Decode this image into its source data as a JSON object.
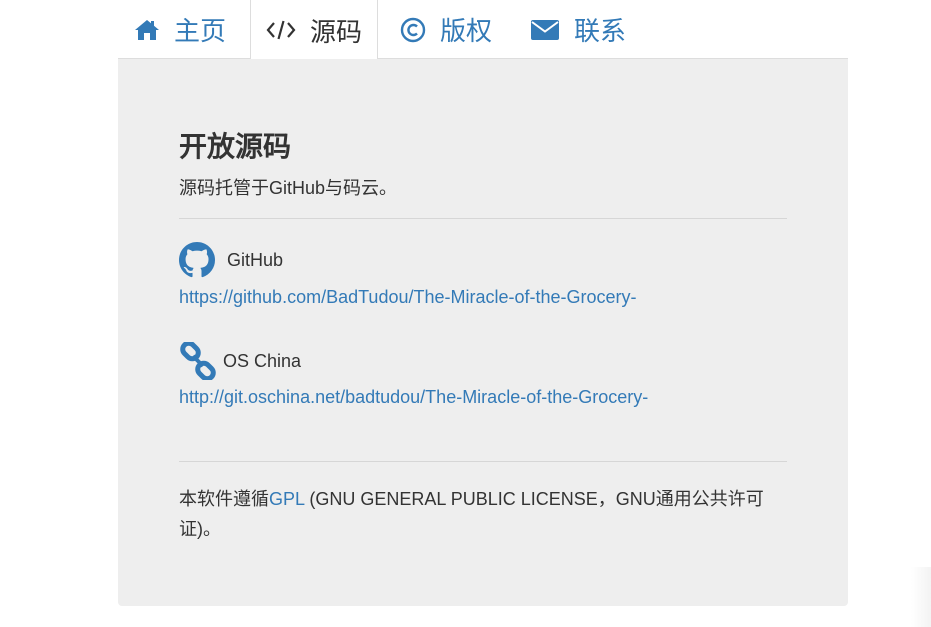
{
  "tabs": [
    {
      "label": "主页",
      "icon": "home-icon"
    },
    {
      "label": "源码",
      "icon": "code-icon"
    },
    {
      "label": "版权",
      "icon": "copyright-icon"
    },
    {
      "label": "联系",
      "icon": "envelope-icon"
    }
  ],
  "active_tab": "源码",
  "panel": {
    "title": "开放源码",
    "subtitle": "源码托管于GitHub与码云。",
    "repos": [
      {
        "name": "GitHub",
        "icon": "github-icon",
        "url": "https://github.com/BadTudou/The-Miracle-of-the-Grocery-"
      },
      {
        "name": "OS China",
        "icon": "link-icon",
        "url": "http://git.oschina.net/badtudou/The-Miracle-of-the-Grocery-"
      }
    ],
    "license": {
      "prefix": "本软件遵循",
      "link_text": "GPL",
      "suffix": " (GNU GENERAL PUBLIC LICENSE，GNU通用公共许可证)。"
    }
  },
  "colors": {
    "link": "#337ab7",
    "panel_bg": "#eeeeee",
    "text": "#333333"
  }
}
